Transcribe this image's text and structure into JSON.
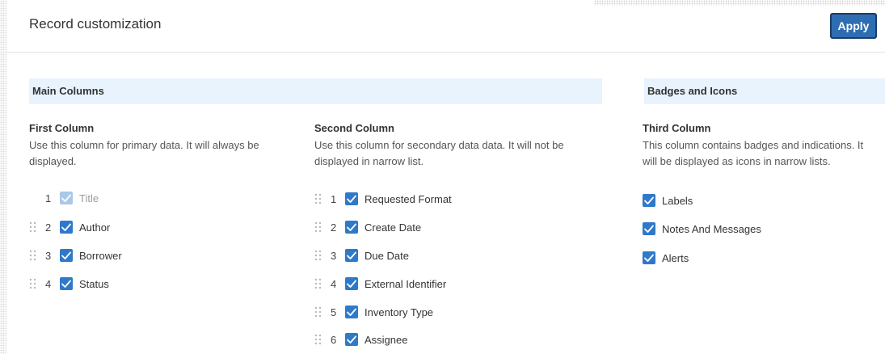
{
  "header": {
    "title": "Record customization",
    "apply_label": "Apply"
  },
  "sections": {
    "main": "Main Columns",
    "badges": "Badges and Icons"
  },
  "first_column": {
    "title": "First Column",
    "description": "Use this column for primary data. It will always be displayed.",
    "items": [
      {
        "num": "1",
        "label": "Title",
        "checked": true,
        "disabled": true
      },
      {
        "num": "2",
        "label": "Author",
        "checked": true
      },
      {
        "num": "3",
        "label": "Borrower",
        "checked": true
      },
      {
        "num": "4",
        "label": "Status",
        "checked": true
      }
    ]
  },
  "second_column": {
    "title": "Second Column",
    "description": "Use this column for secondary data data. It will not be displayed in narrow list.",
    "items": [
      {
        "num": "1",
        "label": "Requested Format",
        "checked": true
      },
      {
        "num": "2",
        "label": "Create Date",
        "checked": true
      },
      {
        "num": "3",
        "label": "Due Date",
        "checked": true
      },
      {
        "num": "4",
        "label": "External Identifier",
        "checked": true
      },
      {
        "num": "5",
        "label": "Inventory Type",
        "checked": true
      },
      {
        "num": "6",
        "label": "Assignee",
        "checked": true
      }
    ]
  },
  "third_column": {
    "title": "Third Column",
    "description": "This column contains badges and indications. It will be displayed as icons in narrow lists.",
    "items": [
      {
        "label": "Labels",
        "checked": true
      },
      {
        "label": "Notes And Messages",
        "checked": true
      },
      {
        "label": "Alerts",
        "checked": true
      }
    ]
  },
  "colors": {
    "accent": "#2f6db3",
    "checkbox": "#2f79c9",
    "section_bg": "#e8f3fd"
  },
  "icons": {
    "drag": "drag-handle-icon",
    "check": "checkmark-icon"
  }
}
